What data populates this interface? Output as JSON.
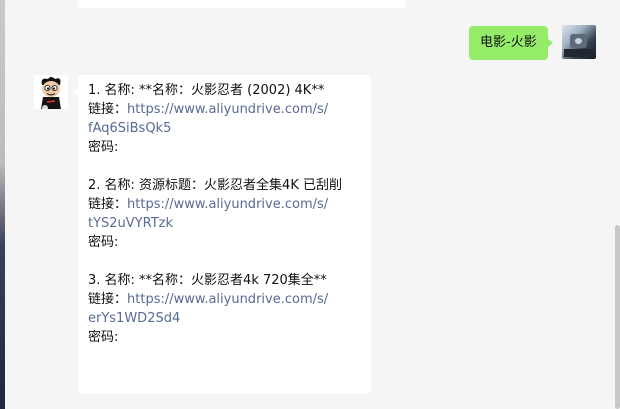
{
  "chat": {
    "outgoing": {
      "text": "电影-火影"
    },
    "incoming": {
      "items": [
        {
          "title": "1. 名称: **名称：火影忍者 (2002) 4K**",
          "link_label": " 链接：",
          "link_part1": "https://www.aliyundrive.com/s/",
          "link_part2": "fAq6SiBsQk5",
          "password_label": "密码:"
        },
        {
          "title": "2. 名称: 资源标题：火影忍者全集4K  已刮削",
          "link_label": " 链接：",
          "link_part1": "https://www.aliyundrive.com/s/",
          "link_part2": "tYS2uVYRTzk",
          "password_label": "密码:"
        },
        {
          "title": "3. 名称: **名称：火影忍者4k 720集全**",
          "link_label": " 链接：",
          "link_part1": "https://www.aliyundrive.com/s/",
          "link_part2": "erYs1WD2Sd4",
          "password_label": "密码:"
        }
      ]
    }
  },
  "colors": {
    "outgoing_bubble": "#95ec69",
    "incoming_bubble": "#ffffff",
    "link": "#576b95",
    "background": "#f5f5f5"
  },
  "icons": {
    "left_avatar": "cartoon-boy-avatar",
    "right_avatar": "photo-avatar"
  }
}
